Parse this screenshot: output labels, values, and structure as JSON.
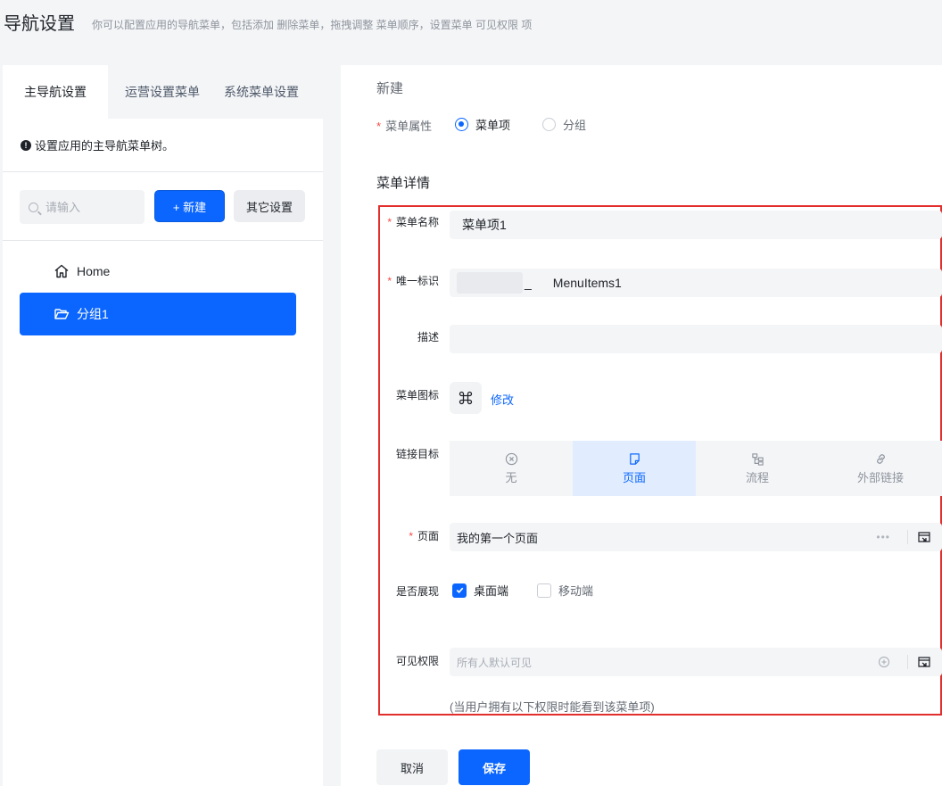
{
  "header": {
    "title": "导航设置",
    "subtitle": "你可以配置应用的导航菜单，包括添加 删除菜单，拖拽调整 菜单顺序，设置菜单 可见权限 项"
  },
  "left": {
    "tabs": [
      {
        "label": "主导航设置",
        "active": true
      },
      {
        "label": "运营设置菜单",
        "active": false
      },
      {
        "label": "系统菜单设置",
        "active": false
      }
    ],
    "info_text": "设置应用的主导航菜单树。",
    "info_icon": "!",
    "search": {
      "placeholder": "请输入",
      "value": ""
    },
    "new_button": "+ 新建",
    "other_button": "其它设置",
    "tree": [
      {
        "label": "Home",
        "icon": "home-icon",
        "selected": false
      },
      {
        "label": "分组1",
        "icon": "folder-open-icon",
        "selected": true
      }
    ]
  },
  "form": {
    "section_title": "新建",
    "attr": {
      "label": "菜单属性",
      "options": [
        {
          "label": "菜单项",
          "checked": true
        },
        {
          "label": "分组",
          "checked": false
        }
      ]
    },
    "details_title": "菜单详情",
    "name": {
      "label": "菜单名称",
      "value": "菜单项1"
    },
    "identifier": {
      "label": "唯一标识",
      "separator": "_",
      "value": "MenuItems1"
    },
    "description": {
      "label": "描述",
      "value": ""
    },
    "icon": {
      "label": "菜单图标",
      "edit_label": "修改",
      "icon": "command-icon"
    },
    "target": {
      "label": "链接目标",
      "options": [
        {
          "label": "无",
          "icon": "circle-x-icon",
          "selected": false
        },
        {
          "label": "页面",
          "icon": "page-icon",
          "selected": true
        },
        {
          "label": "流程",
          "icon": "flow-icon",
          "selected": false
        },
        {
          "label": "外部链接",
          "icon": "link-icon",
          "selected": false
        }
      ]
    },
    "page": {
      "label": "页面",
      "value": "我的第一个页面",
      "dots": "•••"
    },
    "display": {
      "label": "是否展现",
      "options": [
        {
          "label": "桌面端",
          "checked": true
        },
        {
          "label": "移动端",
          "checked": false
        }
      ]
    },
    "permission": {
      "label": "可见权限",
      "placeholder": "所有人默认可见",
      "hint": "(当用户拥有以下权限时能看到该菜单项)"
    },
    "required_mark": "*",
    "cancel_button": "取消",
    "save_button": "保存"
  },
  "colors": {
    "primary": "#0b66ff",
    "danger": "#e32e2e",
    "background": "#f4f5f7"
  }
}
